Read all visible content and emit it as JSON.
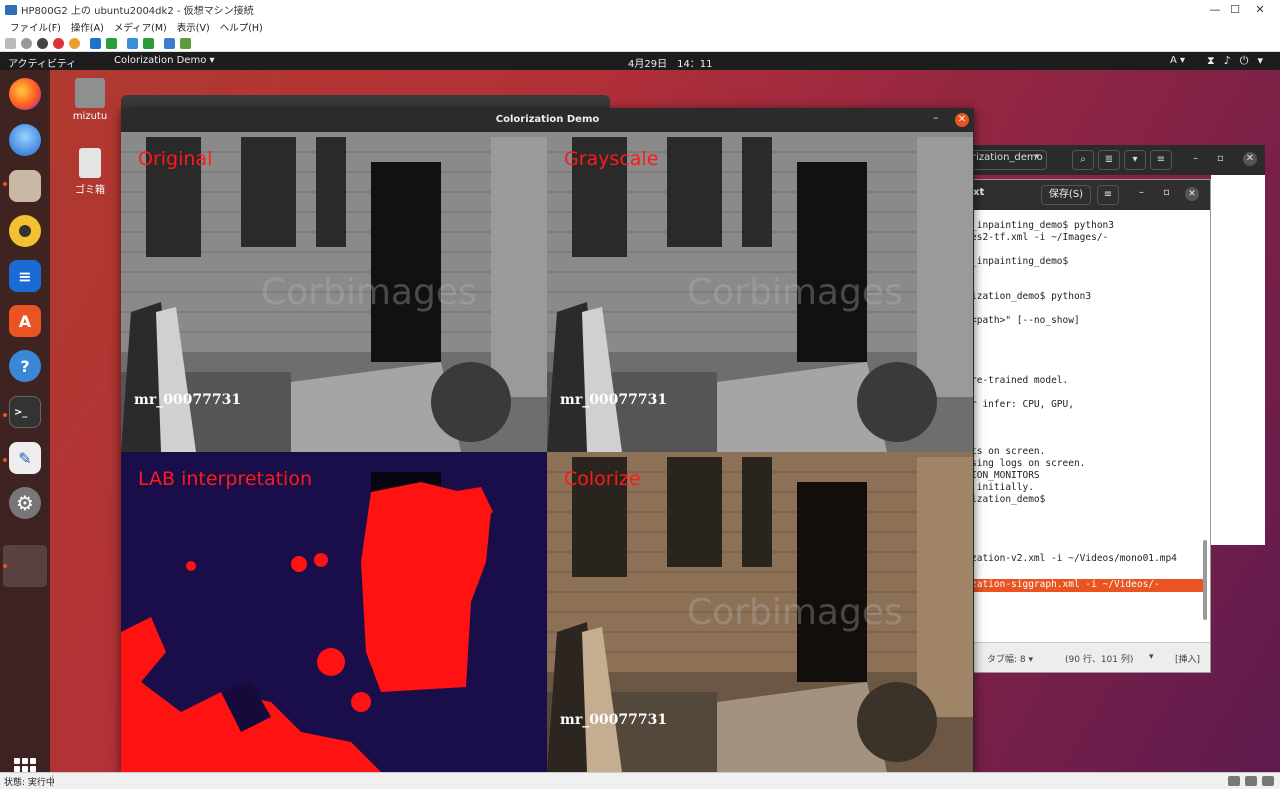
{
  "host": {
    "title": "HP800G2 上の ubuntu2004dk2 - 仮想マシン接続",
    "menu": [
      "ファイル(F)",
      "操作(A)",
      "メディア(M)",
      "表示(V)",
      "ヘルプ(H)"
    ],
    "status": "状態: 実行中"
  },
  "topbar": {
    "activities": "アクティビティ",
    "app_menu": "Colorization Demo ▾",
    "clock": "4月29日　14：11",
    "ime": "A ▾"
  },
  "desktop_icons": [
    {
      "label": "mizutu"
    },
    {
      "label": "ゴミ箱"
    }
  ],
  "dock": {
    "items": [
      "firefox-icon",
      "thunderbird-icon",
      "files-icon",
      "rhythmbox-icon",
      "writer-icon",
      "software-icon",
      "help-icon",
      "terminal-icon",
      "text-editor-icon",
      "settings-icon"
    ]
  },
  "terminal": {
    "title_fragment": "rization_demo",
    "combo_arrow": "▾"
  },
  "gedit": {
    "filename_fragment": "xt",
    "save_label": "保存(S)",
    "menu_label": "≡",
    "lines": [
      "_inpainting_demo$ python3",
      "es2-tf.xml -i ~/Images/-",
      "",
      "_inpainting_demo$",
      "",
      "",
      "ization_demo$ python3",
      "",
      "<path>\" [--no_show]",
      "",
      "",
      "",
      "",
      "re-trained model.",
      "",
      "r infer: CPU, GPU,",
      "",
      "",
      "",
      "ts on screen.",
      "sing logs on screen.",
      "ION_MONITORS",
      " initially.",
      "ization_demo$",
      "",
      "",
      "",
      "",
      "zation-v2.xml -i ~/Videos/mono01.mp4",
      ""
    ],
    "selected_line": "zation-siggraph.xml -i ~/Videos/-",
    "status_tab": "タブ幅: 8 ▾",
    "status_pos": "(90 行、101 列)",
    "status_mode": "[挿入]"
  },
  "demo": {
    "title": "Colorization Demo",
    "panes": [
      {
        "label": "Original",
        "video": "mr_00077731"
      },
      {
        "label": "Grayscale",
        "video": "mr_00077731"
      },
      {
        "label": "LAB interpretation",
        "video": ""
      },
      {
        "label": "Colorize",
        "video": "mr_00077731"
      }
    ],
    "watermark": "Corbimages",
    "accent": "#e95420",
    "label_color": "#ff1a1a"
  }
}
